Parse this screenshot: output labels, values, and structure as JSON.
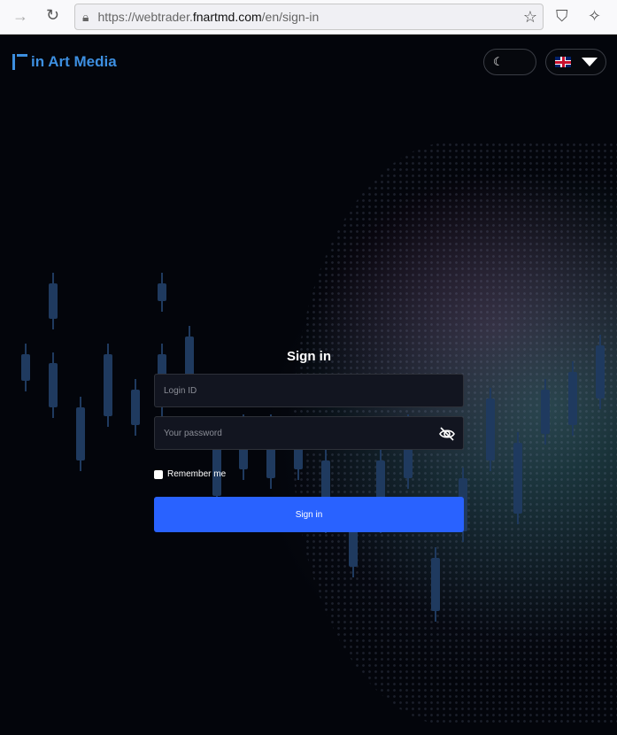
{
  "browser": {
    "url_prefix": "https://webtrader.",
    "url_host": "fnartmd.com",
    "url_path": "/en/sign-in"
  },
  "header": {
    "logo_text": "in Art Media",
    "theme_icon": "moon-icon",
    "language_flag": "uk-flag-icon"
  },
  "form": {
    "title": "Sign in",
    "login_placeholder": "Login ID",
    "password_placeholder": "Your password",
    "remember_label": "Remember me",
    "submit_label": "Sign in"
  },
  "colors": {
    "accent": "#2962ff",
    "logo": "#3d8fe0",
    "background": "#03050b"
  }
}
